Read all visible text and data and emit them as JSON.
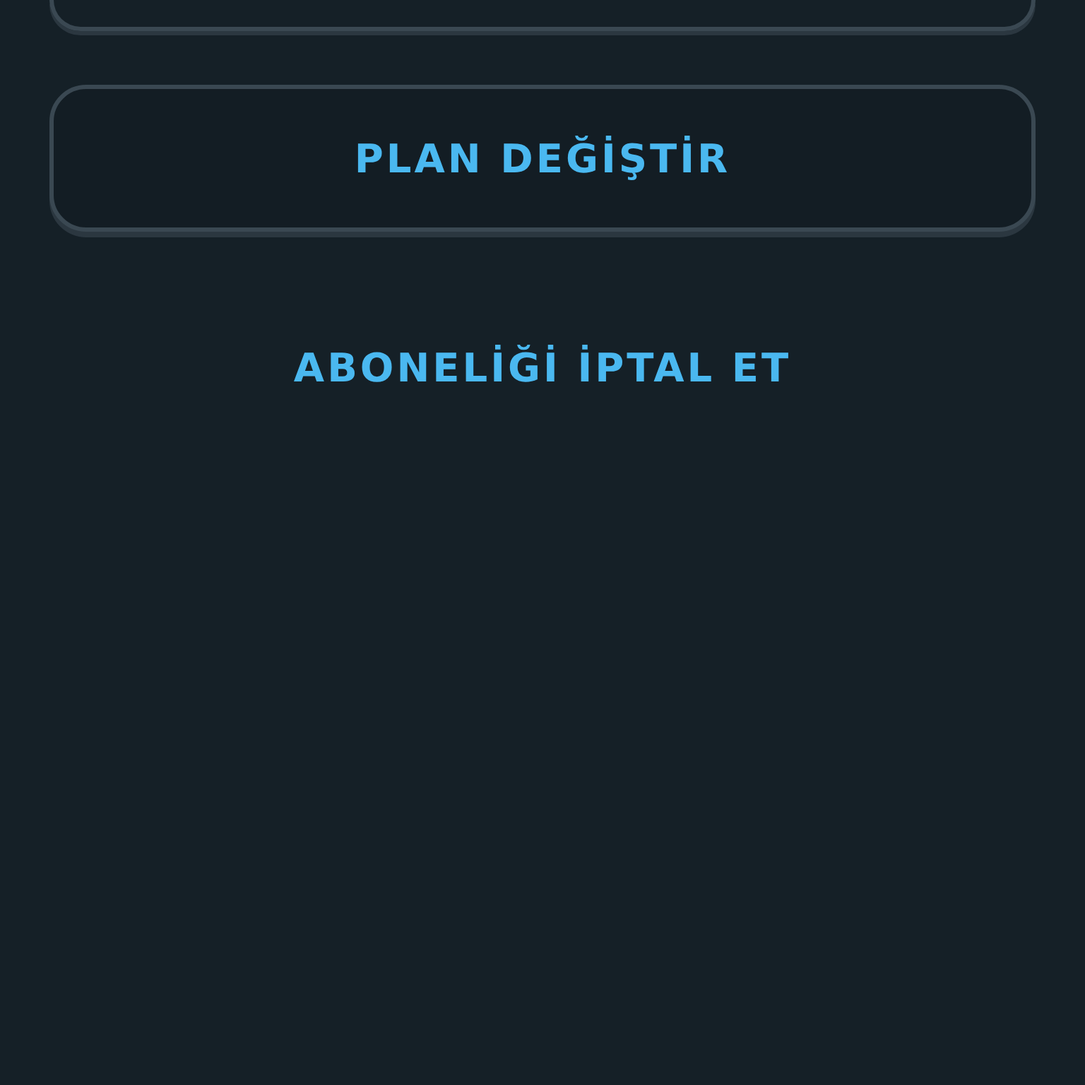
{
  "buttons": [
    {
      "label": "PLAN DEĞİŞTİR",
      "kind": "outlined"
    },
    {
      "label": "ABONELİĞİ İPTAL ET",
      "kind": "text"
    }
  ]
}
